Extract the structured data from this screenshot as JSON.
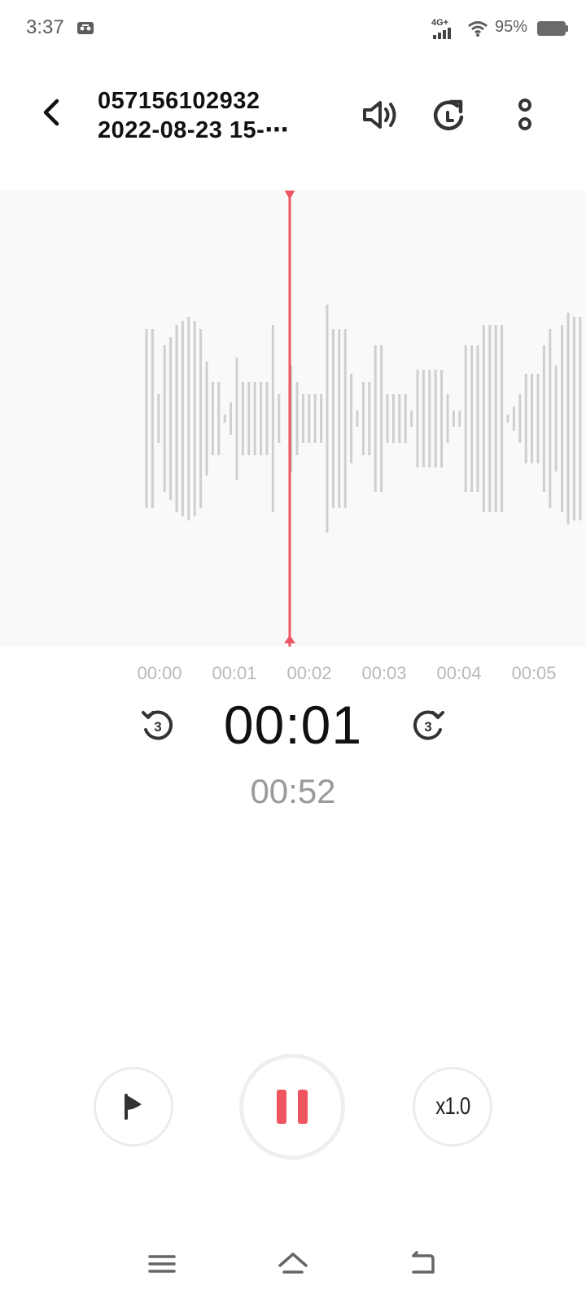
{
  "status_bar": {
    "time": "3:37",
    "network": "4G+",
    "battery": "95%"
  },
  "toolbar": {
    "title_line1": "057156102932",
    "title_line2": "2022-08-23 15-⋯"
  },
  "timeline": {
    "ticks": [
      "00:00",
      "00:01",
      "00:02",
      "00:03",
      "00:04",
      "00:05"
    ]
  },
  "playback": {
    "current_time": "00:01",
    "total_time": "00:52",
    "skip_seconds": "3",
    "speed_label": "x1.0",
    "progress_fraction": 0.02
  },
  "colors": {
    "accent": "#ee5560",
    "waveform_bar": "#cfcfcf",
    "waveform_bg": "#f9f9f9",
    "text_primary": "#111111",
    "text_secondary": "#9a9a9a"
  },
  "icons": {
    "back": "chevron-left-icon",
    "speaker": "speaker-icon",
    "rotate": "rotate-icon",
    "more": "more-vertical-icon",
    "skip_back": "replay-3-icon",
    "skip_forward": "forward-3-icon",
    "flag": "flag-icon",
    "pause": "pause-icon",
    "nav_menu": "menu-icon",
    "nav_home": "home-icon",
    "nav_back": "back-icon"
  }
}
